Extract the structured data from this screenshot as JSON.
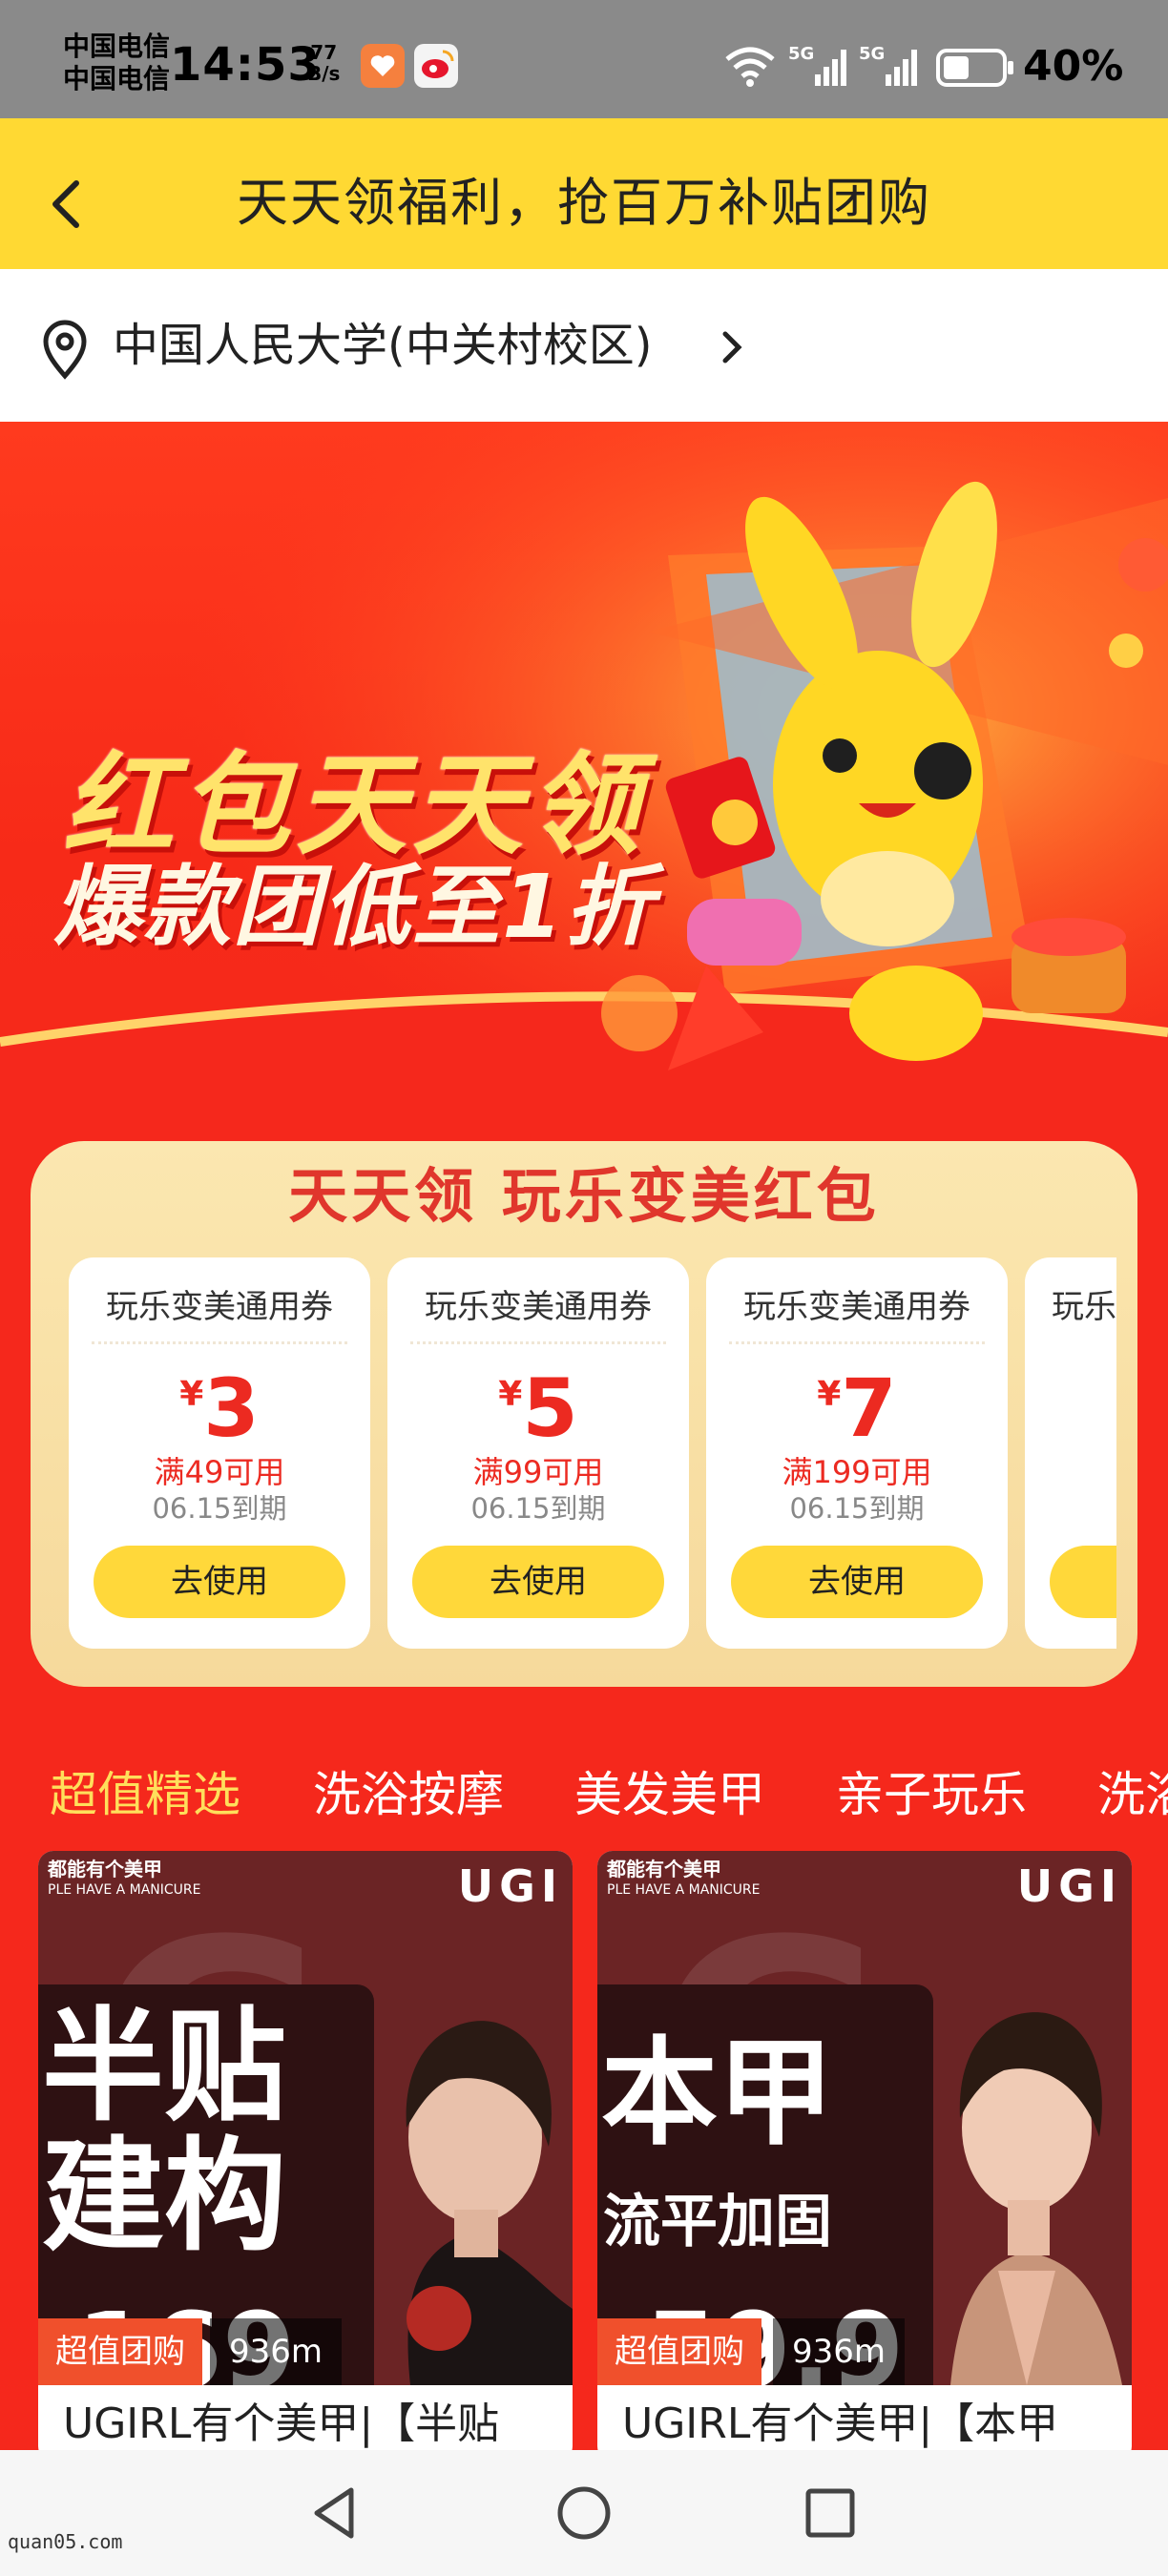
{
  "status_bar": {
    "carrier1": "中国电信",
    "carrier2": "中国电信",
    "time": "14:53",
    "net_speed_value": "77",
    "net_speed_unit": "B/s",
    "battery": "40%"
  },
  "header": {
    "title": "天天领福利，抢百万补贴团购"
  },
  "location": {
    "name": "中国人民大学(中关村校区)"
  },
  "hero": {
    "line1": "红包天天领",
    "line2": "爆款团低至1折"
  },
  "coupon_panel": {
    "title": "天天领 玩乐变美红包",
    "currency": "¥",
    "coupons": [
      {
        "name": "玩乐变美通用券",
        "amount": "3",
        "condition": "满49可用",
        "expiry": "06.15到期",
        "button": "去使用"
      },
      {
        "name": "玩乐变美通用券",
        "amount": "5",
        "condition": "满99可用",
        "expiry": "06.15到期",
        "button": "去使用"
      },
      {
        "name": "玩乐变美通用券",
        "amount": "7",
        "condition": "满199可用",
        "expiry": "06.15到期",
        "button": "去使用"
      },
      {
        "name": "玩乐",
        "amount": "",
        "condition": "",
        "expiry": "",
        "button": ""
      }
    ]
  },
  "tabs": [
    "超值精选",
    "洗浴按摩",
    "美发美甲",
    "亲子玩乐",
    "洗浴"
  ],
  "products": [
    {
      "brand_top1": "都能有个美甲",
      "brand_top2": "PLE HAVE A MANICURE",
      "brand": "UGI",
      "poster_line1": "半贴",
      "poster_line2": "建构",
      "poster_price": "169",
      "badge": "超值团购",
      "distance": "936m",
      "title": "UGIRL有个美甲|【半贴"
    },
    {
      "brand_top1": "都能有个美甲",
      "brand_top2": "PLE HAVE A MANICURE",
      "brand": "UGI",
      "poster_line1": "本甲",
      "poster_sub": "流平加固",
      "poster_price": "59.9",
      "badge": "超值团购",
      "distance": "936m",
      "title": "UGIRL有个美甲|【本甲"
    }
  ],
  "watermark": "quan05.com",
  "colors": {
    "header_bg": "#ffd933",
    "page_bg": "#f5281c",
    "accent_yellow": "#ffd83a",
    "price_red": "#ec2a21"
  }
}
